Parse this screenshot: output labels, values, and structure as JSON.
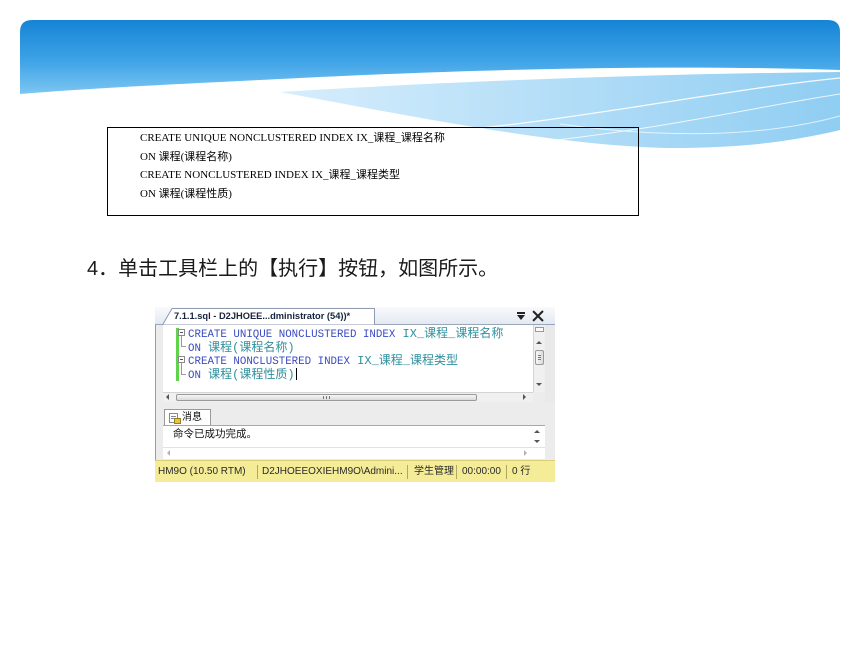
{
  "slide": {
    "code_box": {
      "lines": [
        "CREATE UNIQUE NONCLUSTERED INDEX IX_课程_课程名称",
        "ON 课程(课程名称)",
        "CREATE NONCLUSTERED INDEX IX_课程_课程类型",
        "ON 课程(课程性质)"
      ]
    },
    "step_text": "4．单击工具栏上的【执行】按钮，如图所示。"
  },
  "ssms": {
    "document_tab": {
      "title": "7.1.1.sql - D2JHOEE...dministrator (54))*",
      "icons": [
        "dropdown-icon",
        "close-icon"
      ]
    },
    "editor": {
      "lines": [
        {
          "kw": "CREATE UNIQUE NONCLUSTERED INDEX",
          "rest": " IX_课程_课程名称"
        },
        {
          "kw": "ON",
          "rest": " 课程(课程名称)"
        },
        {
          "kw": "CREATE NONCLUSTERED INDEX",
          "rest": " IX_课程_课程类型"
        },
        {
          "kw": "ON",
          "rest": " 课程(课程性质)"
        }
      ]
    },
    "results": {
      "tab_label": "消息",
      "tab_icon": "messages-icon",
      "message": "命令已成功完成。"
    },
    "status_bar": {
      "items": [
        "HM9O (10.50 RTM)",
        "D2JHOEEOXIEHM9O\\Admini...",
        "学生管理",
        "00:00:00",
        "0 行"
      ]
    }
  },
  "colors": {
    "keyword": "#3a4cc0",
    "identifier": "#2f8f9d",
    "status_bar": "#f5ec98",
    "change_bar": "#5fd34a",
    "header_blue": "#1584d6",
    "header_light": "#86c9f1"
  }
}
